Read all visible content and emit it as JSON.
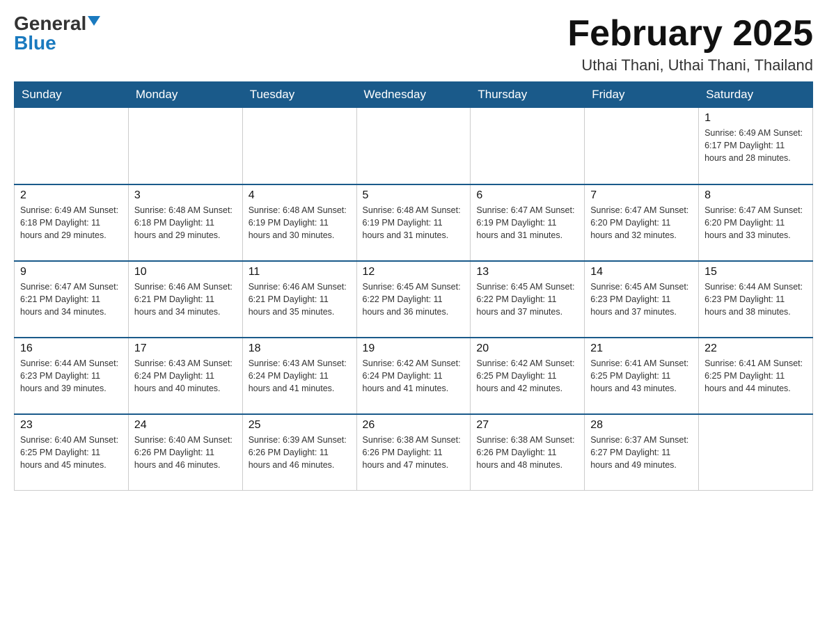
{
  "logo": {
    "general": "General",
    "blue": "Blue"
  },
  "title": "February 2025",
  "subtitle": "Uthai Thani, Uthai Thani, Thailand",
  "days_of_week": [
    "Sunday",
    "Monday",
    "Tuesday",
    "Wednesday",
    "Thursday",
    "Friday",
    "Saturday"
  ],
  "weeks": [
    [
      {
        "day": "",
        "info": ""
      },
      {
        "day": "",
        "info": ""
      },
      {
        "day": "",
        "info": ""
      },
      {
        "day": "",
        "info": ""
      },
      {
        "day": "",
        "info": ""
      },
      {
        "day": "",
        "info": ""
      },
      {
        "day": "1",
        "info": "Sunrise: 6:49 AM\nSunset: 6:17 PM\nDaylight: 11 hours\nand 28 minutes."
      }
    ],
    [
      {
        "day": "2",
        "info": "Sunrise: 6:49 AM\nSunset: 6:18 PM\nDaylight: 11 hours\nand 29 minutes."
      },
      {
        "day": "3",
        "info": "Sunrise: 6:48 AM\nSunset: 6:18 PM\nDaylight: 11 hours\nand 29 minutes."
      },
      {
        "day": "4",
        "info": "Sunrise: 6:48 AM\nSunset: 6:19 PM\nDaylight: 11 hours\nand 30 minutes."
      },
      {
        "day": "5",
        "info": "Sunrise: 6:48 AM\nSunset: 6:19 PM\nDaylight: 11 hours\nand 31 minutes."
      },
      {
        "day": "6",
        "info": "Sunrise: 6:47 AM\nSunset: 6:19 PM\nDaylight: 11 hours\nand 31 minutes."
      },
      {
        "day": "7",
        "info": "Sunrise: 6:47 AM\nSunset: 6:20 PM\nDaylight: 11 hours\nand 32 minutes."
      },
      {
        "day": "8",
        "info": "Sunrise: 6:47 AM\nSunset: 6:20 PM\nDaylight: 11 hours\nand 33 minutes."
      }
    ],
    [
      {
        "day": "9",
        "info": "Sunrise: 6:47 AM\nSunset: 6:21 PM\nDaylight: 11 hours\nand 34 minutes."
      },
      {
        "day": "10",
        "info": "Sunrise: 6:46 AM\nSunset: 6:21 PM\nDaylight: 11 hours\nand 34 minutes."
      },
      {
        "day": "11",
        "info": "Sunrise: 6:46 AM\nSunset: 6:21 PM\nDaylight: 11 hours\nand 35 minutes."
      },
      {
        "day": "12",
        "info": "Sunrise: 6:45 AM\nSunset: 6:22 PM\nDaylight: 11 hours\nand 36 minutes."
      },
      {
        "day": "13",
        "info": "Sunrise: 6:45 AM\nSunset: 6:22 PM\nDaylight: 11 hours\nand 37 minutes."
      },
      {
        "day": "14",
        "info": "Sunrise: 6:45 AM\nSunset: 6:23 PM\nDaylight: 11 hours\nand 37 minutes."
      },
      {
        "day": "15",
        "info": "Sunrise: 6:44 AM\nSunset: 6:23 PM\nDaylight: 11 hours\nand 38 minutes."
      }
    ],
    [
      {
        "day": "16",
        "info": "Sunrise: 6:44 AM\nSunset: 6:23 PM\nDaylight: 11 hours\nand 39 minutes."
      },
      {
        "day": "17",
        "info": "Sunrise: 6:43 AM\nSunset: 6:24 PM\nDaylight: 11 hours\nand 40 minutes."
      },
      {
        "day": "18",
        "info": "Sunrise: 6:43 AM\nSunset: 6:24 PM\nDaylight: 11 hours\nand 41 minutes."
      },
      {
        "day": "19",
        "info": "Sunrise: 6:42 AM\nSunset: 6:24 PM\nDaylight: 11 hours\nand 41 minutes."
      },
      {
        "day": "20",
        "info": "Sunrise: 6:42 AM\nSunset: 6:25 PM\nDaylight: 11 hours\nand 42 minutes."
      },
      {
        "day": "21",
        "info": "Sunrise: 6:41 AM\nSunset: 6:25 PM\nDaylight: 11 hours\nand 43 minutes."
      },
      {
        "day": "22",
        "info": "Sunrise: 6:41 AM\nSunset: 6:25 PM\nDaylight: 11 hours\nand 44 minutes."
      }
    ],
    [
      {
        "day": "23",
        "info": "Sunrise: 6:40 AM\nSunset: 6:25 PM\nDaylight: 11 hours\nand 45 minutes."
      },
      {
        "day": "24",
        "info": "Sunrise: 6:40 AM\nSunset: 6:26 PM\nDaylight: 11 hours\nand 46 minutes."
      },
      {
        "day": "25",
        "info": "Sunrise: 6:39 AM\nSunset: 6:26 PM\nDaylight: 11 hours\nand 46 minutes."
      },
      {
        "day": "26",
        "info": "Sunrise: 6:38 AM\nSunset: 6:26 PM\nDaylight: 11 hours\nand 47 minutes."
      },
      {
        "day": "27",
        "info": "Sunrise: 6:38 AM\nSunset: 6:26 PM\nDaylight: 11 hours\nand 48 minutes."
      },
      {
        "day": "28",
        "info": "Sunrise: 6:37 AM\nSunset: 6:27 PM\nDaylight: 11 hours\nand 49 minutes."
      },
      {
        "day": "",
        "info": ""
      }
    ]
  ]
}
